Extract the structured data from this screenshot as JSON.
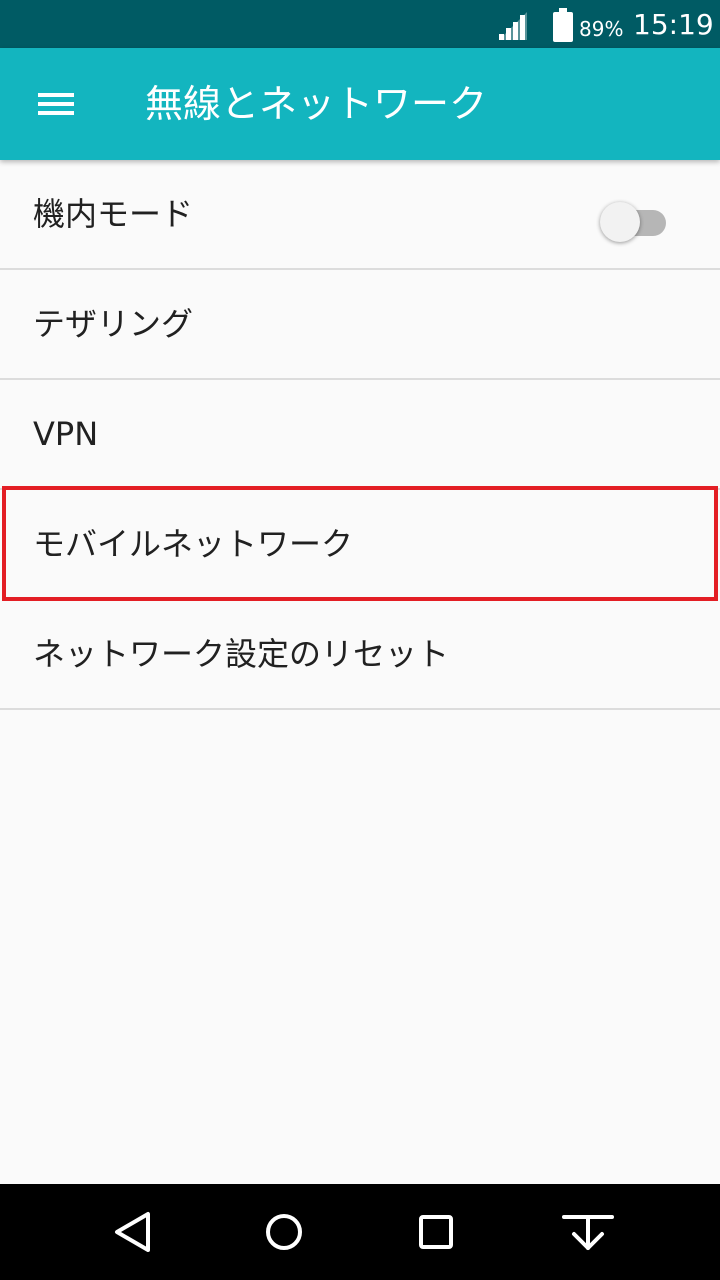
{
  "status_bar": {
    "battery_percent": "89%",
    "time": "15:19",
    "icons": [
      "signal-icon",
      "battery-icon"
    ]
  },
  "app_bar": {
    "title": "無線とネットワーク",
    "menu_icon": "hamburger-menu-icon",
    "color": "#13b5bf"
  },
  "list": {
    "items": [
      {
        "label": "機内モード",
        "toggle": false
      },
      {
        "label": "テザリング"
      },
      {
        "label": "VPN"
      },
      {
        "label": "モバイルネットワーク",
        "highlighted": true
      },
      {
        "label": "ネットワーク設定のリセット"
      }
    ]
  },
  "highlight_color": "#e31e24",
  "nav_bar": {
    "buttons": [
      "back-icon",
      "home-icon",
      "recents-icon",
      "hide-nav-icon"
    ]
  }
}
